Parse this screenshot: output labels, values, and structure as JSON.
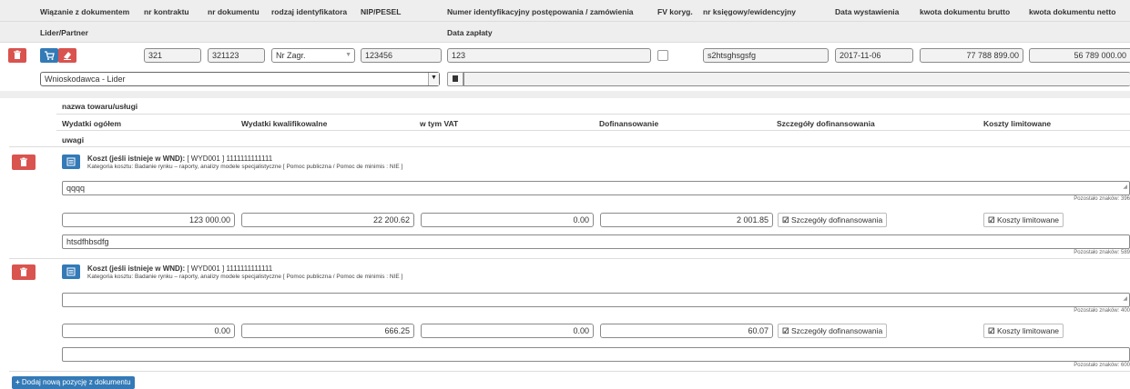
{
  "document": {
    "headers": {
      "linking": "Wiązanie z dokumentem",
      "contract_no": "nr kontraktu",
      "doc_no": "nr dokumentu",
      "id_type": "rodzaj identyfikatora",
      "nip": "NIP/PESEL",
      "proceeding_no": "Numer identyfikacyjny postępowania / zamówienia",
      "fv": "FV koryg.",
      "ledger_no": "nr księgowy/ewidencyjny",
      "issue_date": "Data wystawienia",
      "gross": "kwota dokumentu brutto",
      "net": "kwota dokumentu netto",
      "partner": "Lider/Partner",
      "payment_date": "Data zapłaty"
    },
    "values": {
      "contract_no": "321",
      "doc_no": "321123",
      "id_type": "Nr Zagr.",
      "nip": "123456",
      "proceeding_no": "123",
      "ledger_no": "s2htsghsgsfg",
      "issue_date": "2017-11-06",
      "gross": "77 788 899.00",
      "net": "56 789 000.00",
      "partner": "Wnioskodawca - Lider"
    }
  },
  "items_header": {
    "name": "nazwa towaru/usługi",
    "total": "Wydatki ogółem",
    "eligible": "Wydatki kwalifikowalne",
    "vat": "w tym VAT",
    "cofinancing": "Dofinansowanie",
    "details": "Szczegóły dofinansowania",
    "limited": "Koszty limitowane",
    "notes": "uwagi"
  },
  "items": [
    {
      "cost_label": "Koszt (jeśli istnieje w WND):",
      "cost_value": "[ WYD001 ] 1111111111111",
      "category": "Kategoria kosztu: Badanie rynku – raporty, analizy modele specjalistyczne [ Pomoc publiczna / Pomoc de minimis : NIE ]",
      "name": "qqqq",
      "name_counter": "Pozostało znaków: 396",
      "total": "123 000.00",
      "eligible": "22 200.62",
      "vat": "0.00",
      "cofinancing": "2 001.85",
      "details_btn": "Szczegóły dofinansowania",
      "limited_btn": "Koszty limitowane",
      "notes": "htsdfhbsdfg",
      "notes_counter": "Pozostało znaków: 589"
    },
    {
      "cost_label": "Koszt (jeśli istnieje w WND):",
      "cost_value": "[ WYD001 ] 1111111111111",
      "category": "Kategoria kosztu: Badanie rynku – raporty, analizy modele specjalistyczne [ Pomoc publiczna / Pomoc de minimis : NIE ]",
      "name": "",
      "name_counter": "Pozostało znaków: 400",
      "total": "0.00",
      "eligible": "666.25",
      "vat": "0.00",
      "cofinancing": "60.07",
      "details_btn": "Szczegóły dofinansowania",
      "limited_btn": "Koszty limitowane",
      "notes": "",
      "notes_counter": "Pozostało znaków: 600"
    }
  ],
  "add_button": "Dodaj nową pozycję z dokumentu",
  "colors": {
    "danger": "#d9534f",
    "primary": "#337ab7",
    "header_band": "#eeeeee"
  }
}
